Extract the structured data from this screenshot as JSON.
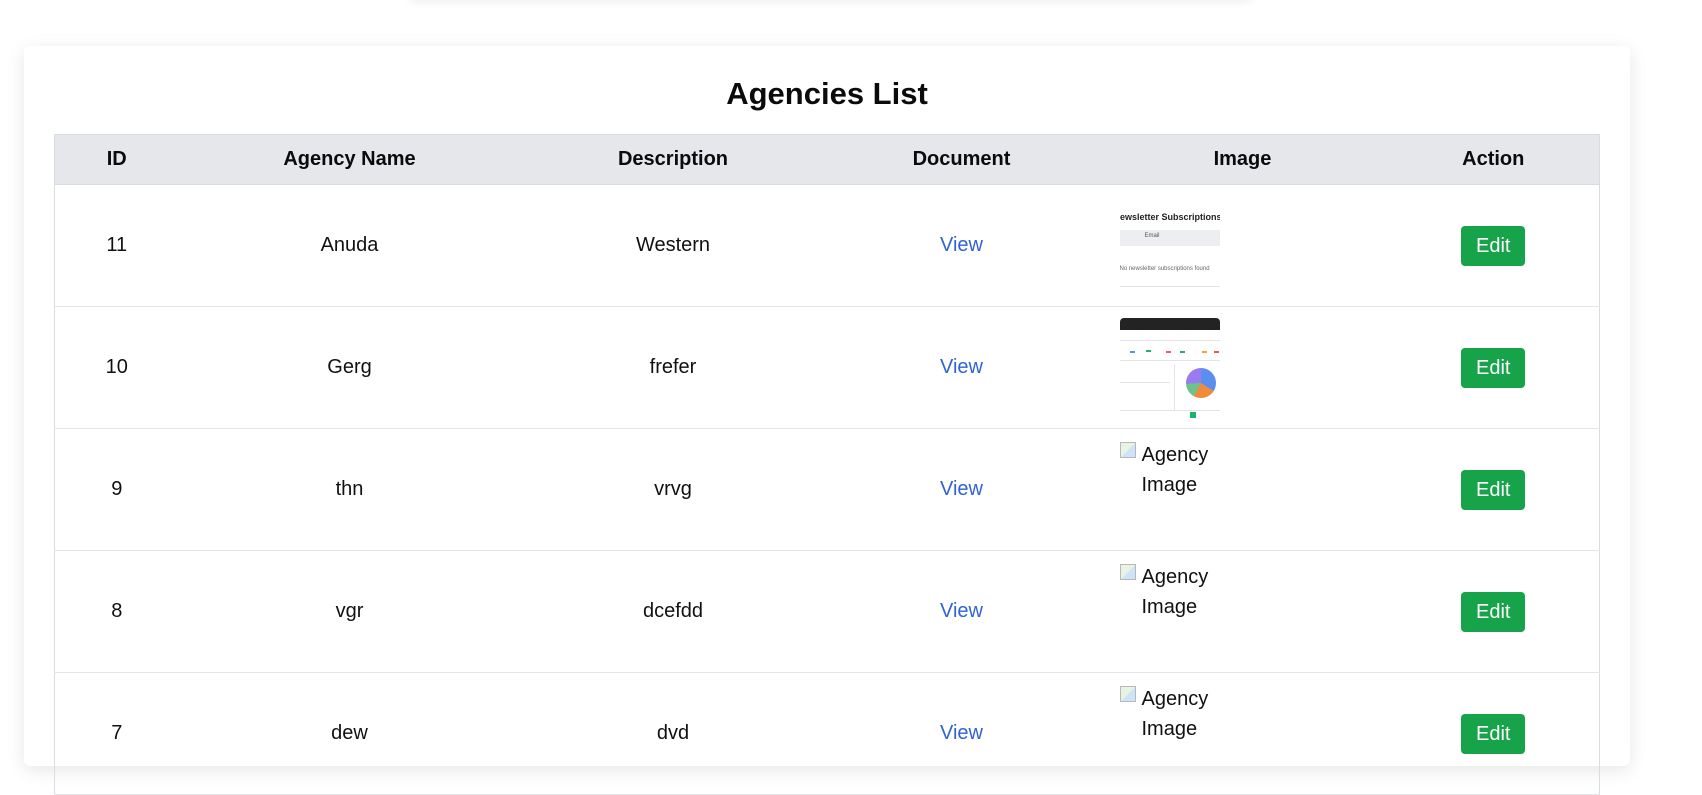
{
  "page": {
    "title": "Agencies List"
  },
  "table": {
    "columns": [
      "ID",
      "Agency Name",
      "Description",
      "Document",
      "Image",
      "Action"
    ],
    "rows": [
      {
        "id": "11",
        "name": "Anuda",
        "description": "Western",
        "document": "View",
        "image_type": "thumbnail-newsletter",
        "action": "Edit"
      },
      {
        "id": "10",
        "name": "Gerg",
        "description": "frefer",
        "document": "View",
        "image_type": "thumbnail-dashboard",
        "action": "Edit"
      },
      {
        "id": "9",
        "name": "thn",
        "description": "vrvg",
        "document": "View",
        "image_type": "broken",
        "image_alt": "Agency Image",
        "action": "Edit"
      },
      {
        "id": "8",
        "name": "vgr",
        "description": "dcefdd",
        "document": "View",
        "image_type": "broken",
        "image_alt": "Agency Image",
        "action": "Edit"
      },
      {
        "id": "7",
        "name": "dew",
        "description": "dvd",
        "document": "View",
        "image_type": "broken",
        "image_alt": "Agency Image",
        "action": "Edit"
      }
    ]
  },
  "thumbnails": {
    "newsletter": {
      "title": "Newsletter Subscriptions",
      "header": "Email",
      "empty_text": "No newsletter subscriptions found"
    }
  },
  "colors": {
    "header_bg": "#e6e7eb",
    "link": "#2f63d6",
    "edit_button": "#16a34a"
  },
  "icons": {
    "broken_image": "broken-image-icon"
  }
}
